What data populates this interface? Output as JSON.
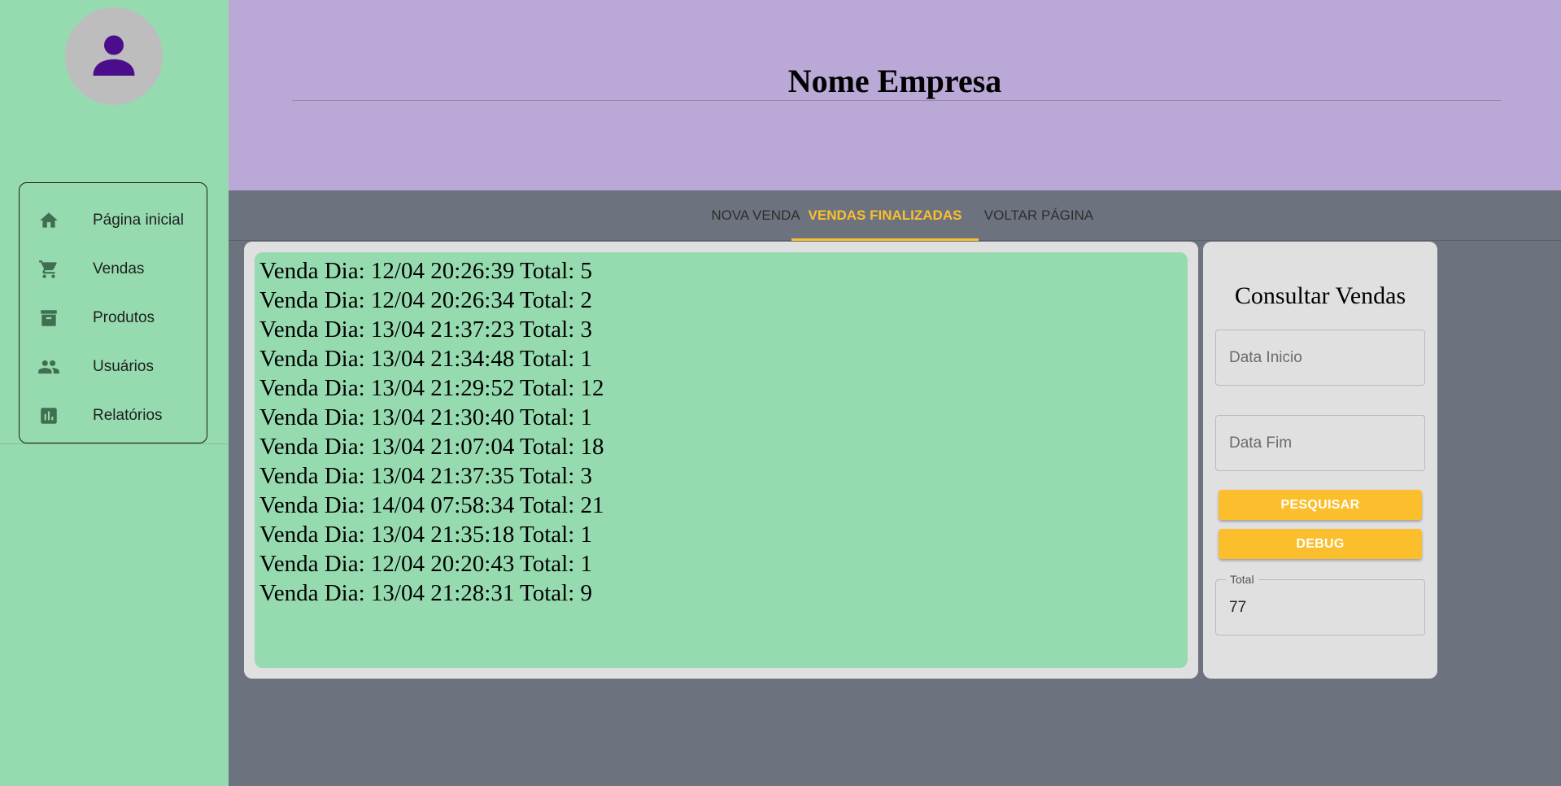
{
  "sidebar": {
    "items": [
      {
        "label": "Página inicial",
        "icon": "home-icon"
      },
      {
        "label": "Vendas",
        "icon": "cart-icon"
      },
      {
        "label": "Produtos",
        "icon": "archive-icon"
      },
      {
        "label": "Usuários",
        "icon": "users-icon"
      },
      {
        "label": "Relatórios",
        "icon": "chart-icon"
      }
    ]
  },
  "header": {
    "title": "Nome Empresa"
  },
  "tabs": [
    {
      "label": "NOVA VENDA",
      "active": false
    },
    {
      "label": "VENDAS FINALIZADAS",
      "active": true
    },
    {
      "label": "VOLTAR PÁGINA",
      "active": false
    }
  ],
  "sales": [
    "Venda Dia: 12/04 20:26:39 Total: 5",
    "Venda Dia: 12/04 20:26:34 Total: 2",
    "Venda Dia: 13/04 21:37:23 Total: 3",
    "Venda Dia: 13/04 21:34:48 Total: 1",
    "Venda Dia: 13/04 21:29:52 Total: 12",
    "Venda Dia: 13/04 21:30:40 Total: 1",
    "Venda Dia: 13/04 21:07:04 Total: 18",
    "Venda Dia: 13/04 21:37:35 Total: 3",
    "Venda Dia: 14/04 07:58:34 Total: 21",
    "Venda Dia: 13/04 21:35:18 Total: 1",
    "Venda Dia: 12/04 20:20:43 Total: 1",
    "Venda Dia: 13/04 21:28:31 Total: 9"
  ],
  "query": {
    "title": "Consultar Vendas",
    "start_placeholder": "Data Inicio",
    "end_placeholder": "Data Fim",
    "search_label": "PESQUISAR",
    "debug_label": "DEBUG",
    "total_label": "Total",
    "total_value": "77"
  },
  "colors": {
    "sidebar_bg": "#96dbb0",
    "header_bg": "#baa9d6",
    "content_bg": "#6d737e",
    "accent": "#fbbf2d",
    "avatar_icon": "#4b0d8c"
  }
}
